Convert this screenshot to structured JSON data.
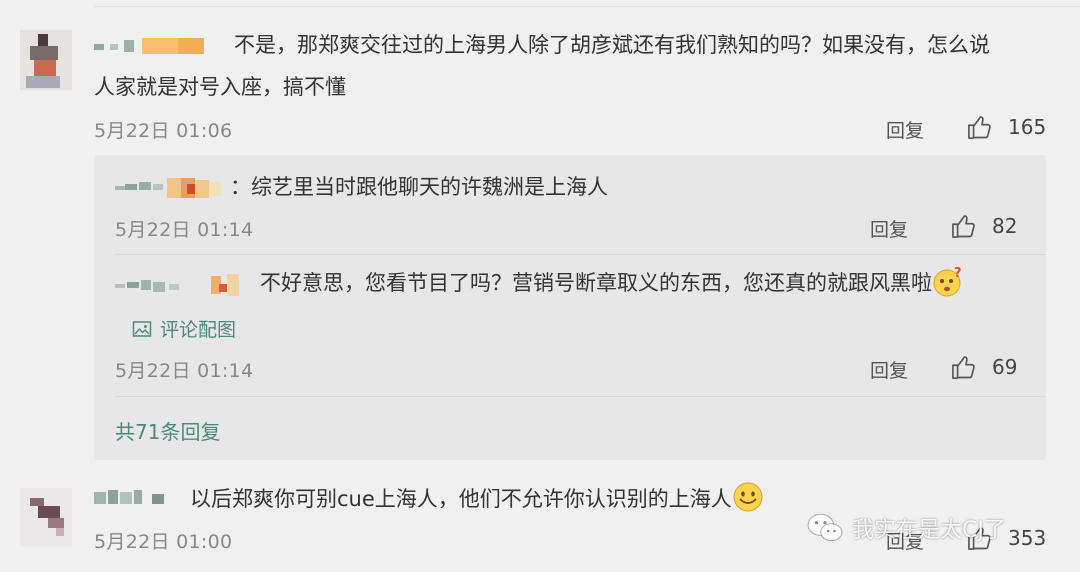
{
  "comments": [
    {
      "text_lines": [
        "不是，那郑爽交往过的上海男人除了胡彦斌还有我们熟知的吗？如果没有，怎么说",
        "人家就是对号入座，搞不懂"
      ],
      "date": "5月22日 01:06",
      "reply_label": "回复",
      "likes": "165",
      "replies": [
        {
          "text": "：综艺里当时跟他聊天的许魏洲是上海人",
          "date": "5月22日 01:14",
          "reply_label": "回复",
          "likes": "82"
        },
        {
          "text": "不好意思，您看节目了吗？营销号断章取义的东西，您还真的就跟风黑啦",
          "emoji": "confused-face",
          "image_link": "评论配图",
          "date": "5月22日 01:14",
          "reply_label": "回复",
          "likes": "69"
        }
      ],
      "more_replies": "共71条回复"
    },
    {
      "text": "以后郑爽你可别cue上海人，他们不允许你认识别的上海人",
      "emoji": "smile-face",
      "date": "5月22日 01:00",
      "reply_label": "回复",
      "likes": "353"
    }
  ],
  "watermark": {
    "text": "我实在是太CJ了",
    "icon": "wechat-icon"
  },
  "colors": {
    "background": "#f0f0f0",
    "reply_card": "#e7e7e7",
    "link": "#4a8a7c",
    "meta": "#888888"
  }
}
